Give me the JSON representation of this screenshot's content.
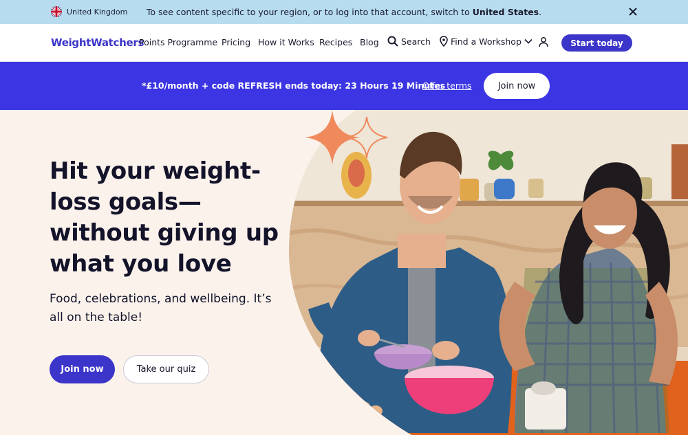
{
  "region_bar": {
    "country": "United Kingdom",
    "message_prefix": "To see content specific to your region, or to log into that account, switch to ",
    "message_country": "United States",
    "message_suffix": ".",
    "close_icon": "close-icon"
  },
  "nav": {
    "logo": "WeightWatchers",
    "items": [
      "Points Programme",
      "Pricing",
      "How it Works",
      "Recipes",
      "Blog"
    ],
    "search_label": "Search",
    "workshop_label": "Find a Workshop",
    "cta_label": "Start today",
    "icons": [
      "search-icon",
      "location-pin-icon",
      "chevron-down-icon",
      "user-icon"
    ]
  },
  "promo": {
    "text": "*£10/month + code REFRESH ends today: 23 Hours 19 Minutes",
    "link": "Offer terms",
    "button": "Join now"
  },
  "hero": {
    "title": "Hit your weight-loss goals—without giving up what you love",
    "subtitle": "Food, celebrations, and wellbeing. It’s all on the table!",
    "primary_button": "Join now",
    "secondary_button": "Take our quiz"
  },
  "colors": {
    "brand": "#3b35c9",
    "promo_bg": "#3b35e3",
    "region_bg": "#b7dcf0",
    "hero_bg": "#fbf2ec",
    "accent": "#f08a5d"
  }
}
